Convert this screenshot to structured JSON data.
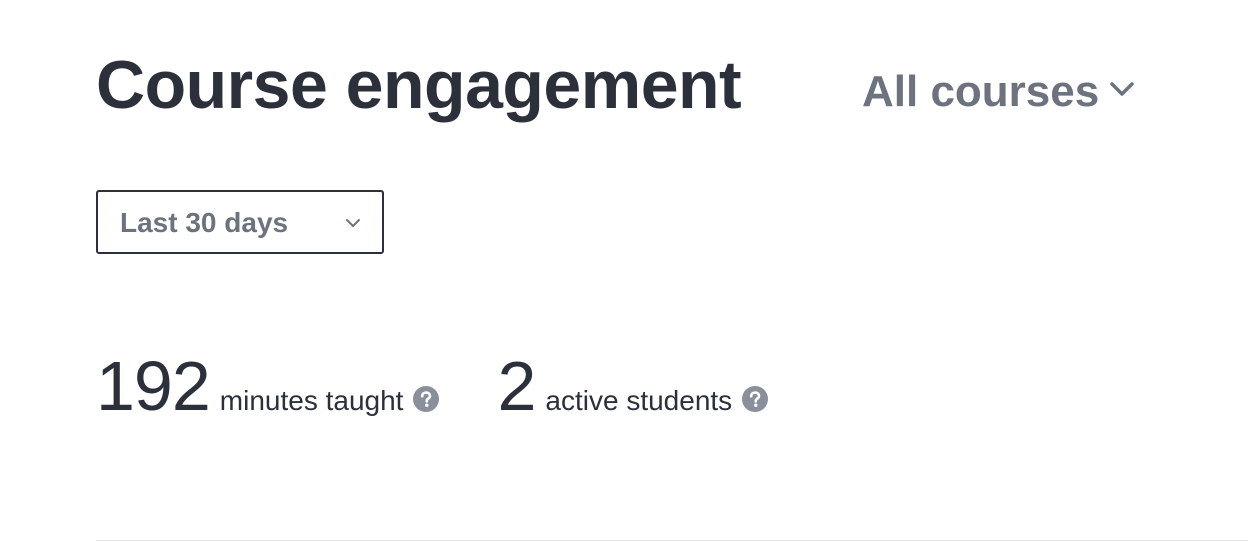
{
  "header": {
    "title": "Course engagement",
    "course_filter": {
      "selected": "All courses",
      "icon": "chevron-down-icon"
    }
  },
  "filters": {
    "date_range": {
      "selected": "Last 30 days",
      "icon": "chevron-down-icon"
    }
  },
  "stats": [
    {
      "value": "192",
      "label": "minutes taught",
      "icon": "help-icon"
    },
    {
      "value": "2",
      "label": "active students",
      "icon": "help-icon"
    }
  ],
  "colors": {
    "title_text": "#2b303b",
    "muted_text": "#6d727f",
    "help_icon": "#8a8f9c",
    "divider": "#e6e8ec"
  }
}
